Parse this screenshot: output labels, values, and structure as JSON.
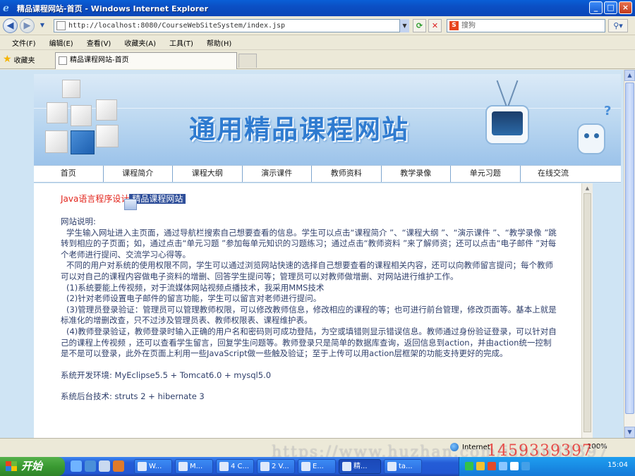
{
  "window": {
    "title": "精品课程网站-首页 - Windows Internet Explorer",
    "controls": {
      "minimize": "_",
      "maximize": "□",
      "close": "×"
    }
  },
  "toolbar": {
    "address": "http://localhost:8080/CourseWebSiteSystem/index.jsp",
    "search_placeholder": "搜狗",
    "search_logo": "S"
  },
  "menu": [
    "文件(F)",
    "编辑(E)",
    "查看(V)",
    "收藏夹(A)",
    "工具(T)",
    "帮助(H)"
  ],
  "favorites": {
    "button_label": "收藏夹",
    "tab_title": "精品课程网站-首页"
  },
  "site": {
    "banner_title": "通用精品课程网站",
    "nav": [
      "首页",
      "课程简介",
      "课程大纲",
      "演示课件",
      "教师资料",
      "教学录像",
      "单元习题",
      "在线交流"
    ],
    "content_title_prefix": "Java语言程序设计",
    "content_title_selected": "精品课程网站",
    "description_heading": "网站说明:",
    "paragraphs": [
      "学生输入网址进入主页面，通过导航栏搜索自己想要查看的信息。学生可以点击“课程简介 ”、“课程大纲 ”、“演示课件 ”、“教学录像 ”跳转到相应的子页面；如，通过点击“单元习题 ”参加每单元知识的习题练习；通过点击“教师资料 ”来了解师资；还可以点击“电子邮件 ”对每个老师进行提问、交流学习心得等。",
      "不同的用户对系统的使用权限不同，学生可以通过浏览网站快速的选择自己想要查看的课程相关内容，还可以向教师留言提问；每个教师可以对自己的课程内容做电子资料的增删、回答学生提问等；管理员可以对教师做增删、对网站进行维护工作。",
      "(1)系统要能上传视频，对于流媒体网站视频点播技术，我采用MMS技术",
      "(2)针对老师设置电子邮件的留言功能，学生可以留言对老师进行提问。",
      "(3)管理员登录验证：管理员可以管理教师权限，可以修改教师信息，修改相应的课程的等；也可进行前台管理，修改页面等。基本上就是标准化的增删改查，只不过涉及管理员表、教师权限表、课程维护表。",
      "(4)教师登录验证，教师登录时输入正确的用户名和密码则可成功登陆，为空或填错则显示错误信息。教师通过身份验证登录，可以针对自己的课程上传视频 ，还可以查看学生留言，回复学生问题等。教师登录只是简单的数据库查询，返回信息到action，并由action统一控制是不是可以登录，此外在页面上利用一些JavaScript做一些触及验证；至于上传可以用action层框架的功能支持更好的完成。"
    ],
    "dev_env": "系统开发环境: MyEclipse5.5 + Tomcat6.0 + mysql5.0",
    "backend": "系统后台技术: struts 2 + hibernate 3"
  },
  "status": {
    "zone": "Internet",
    "zoom": "100%"
  },
  "overlay": {
    "watermark": "https://www.huzhan.com/ishop39397",
    "phone": "1459339397"
  },
  "taskbar": {
    "start": "开始",
    "items": [
      "W...",
      "M...",
      "4 C...",
      "2 V...",
      "E...",
      "精...",
      "ta..."
    ],
    "clock": "15:04"
  },
  "colors": {
    "title_bar": "#0b4fc4",
    "banner_text": "#2f7bd0",
    "content_title": "#e2231a",
    "body_text": "#2f3f6b",
    "taskbar": "#245dd7",
    "start_button": "#3a9a32"
  }
}
